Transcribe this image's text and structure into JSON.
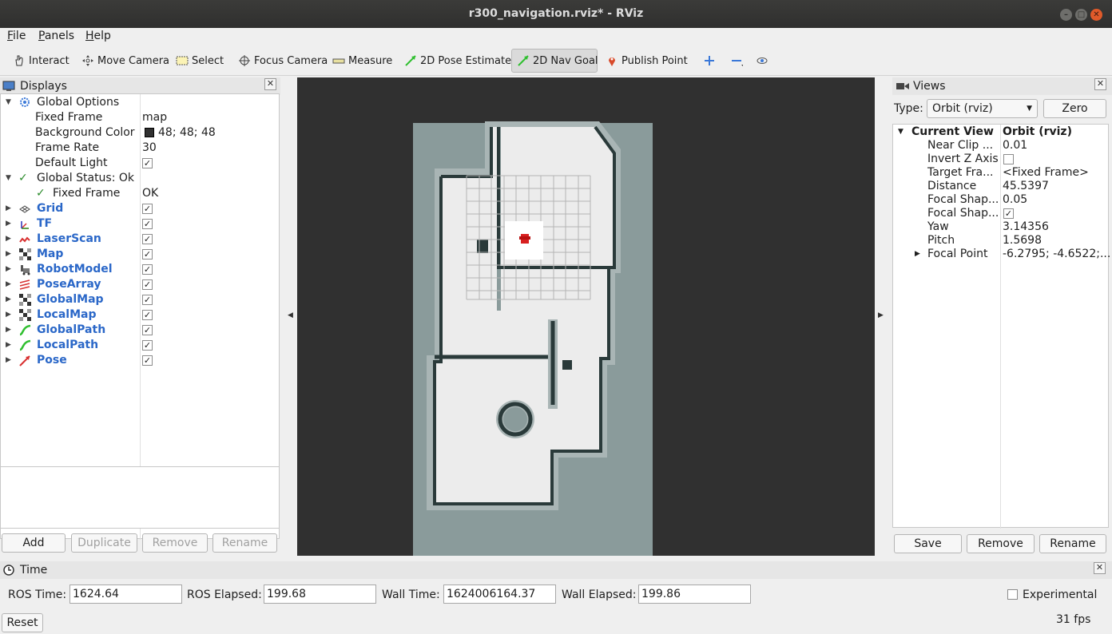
{
  "window": {
    "title": "r300_navigation.rviz* - RViz"
  },
  "menu": [
    {
      "label": "File",
      "key": "F",
      "rest": "ile"
    },
    {
      "label": "Panels",
      "key": "P",
      "rest": "anels"
    },
    {
      "label": "Help",
      "key": "H",
      "rest": "elp"
    }
  ],
  "toolbar": {
    "interact": "Interact",
    "move_camera": "Move Camera",
    "select": "Select",
    "focus_camera": "Focus Camera",
    "measure": "Measure",
    "pose_estimate": "2D Pose Estimate",
    "nav_goal": "2D Nav Goal",
    "publish_point": "Publish Point"
  },
  "displays": {
    "title": "Displays",
    "global_options": "Global Options",
    "fixed_frame_label": "Fixed Frame",
    "fixed_frame_value": "map",
    "background_color_label": "Background Color",
    "background_color_value": "48; 48; 48",
    "background_color_hex": "#303030",
    "frame_rate_label": "Frame Rate",
    "frame_rate_value": "30",
    "default_light_label": "Default Light",
    "global_status": "Global Status: Ok",
    "status_fixed_frame": "Fixed Frame",
    "status_ok": "OK",
    "items": [
      {
        "label": "Grid",
        "icon": "grid-icon"
      },
      {
        "label": "TF",
        "icon": "tf-icon"
      },
      {
        "label": "LaserScan",
        "icon": "laserscan-icon"
      },
      {
        "label": "Map",
        "icon": "map-icon"
      },
      {
        "label": "RobotModel",
        "icon": "robotmodel-icon"
      },
      {
        "label": "PoseArray",
        "icon": "posearray-icon"
      },
      {
        "label": "GlobalMap",
        "icon": "map-icon"
      },
      {
        "label": "LocalMap",
        "icon": "map-icon"
      },
      {
        "label": "GlobalPath",
        "icon": "path-icon"
      },
      {
        "label": "LocalPath",
        "icon": "path-icon"
      },
      {
        "label": "Pose",
        "icon": "pose-icon"
      }
    ],
    "buttons": {
      "add": "Add",
      "duplicate": "Duplicate",
      "remove": "Remove",
      "rename": "Rename"
    }
  },
  "views": {
    "title": "Views",
    "type_label": "Type:",
    "type_value": "Orbit (rviz)",
    "zero": "Zero",
    "current_view": "Current View",
    "current_view_value": "Orbit (rviz)",
    "props": [
      {
        "label": "Near Clip ...",
        "value": "0.01"
      },
      {
        "label": "Invert Z Axis",
        "value": ""
      },
      {
        "label": "Target Fra...",
        "value": "<Fixed Frame>"
      },
      {
        "label": "Distance",
        "value": "45.5397"
      },
      {
        "label": "Focal Shap...",
        "value": "0.05"
      },
      {
        "label": "Focal Shap...",
        "value": ""
      },
      {
        "label": "Yaw",
        "value": "3.14356"
      },
      {
        "label": "Pitch",
        "value": "1.5698"
      },
      {
        "label": "Focal Point",
        "value": "-6.2795; -4.6522;..."
      }
    ],
    "buttons": {
      "save": "Save",
      "remove": "Remove",
      "rename": "Rename"
    }
  },
  "time": {
    "title": "Time",
    "ros_time_label": "ROS Time:",
    "ros_time": "1624.64",
    "ros_elapsed_label": "ROS Elapsed:",
    "ros_elapsed": "199.68",
    "wall_time_label": "Wall Time:",
    "wall_time": "1624006164.37",
    "wall_elapsed_label": "Wall Elapsed:",
    "wall_elapsed": "199.86",
    "experimental": "Experimental",
    "reset": "Reset",
    "fps": "31 fps"
  },
  "colors": {
    "accent_blue": "#2a67c8",
    "map_free": "#ececec",
    "map_unknown": "#8a9b9b",
    "obstacle": "#2a3a3a"
  }
}
